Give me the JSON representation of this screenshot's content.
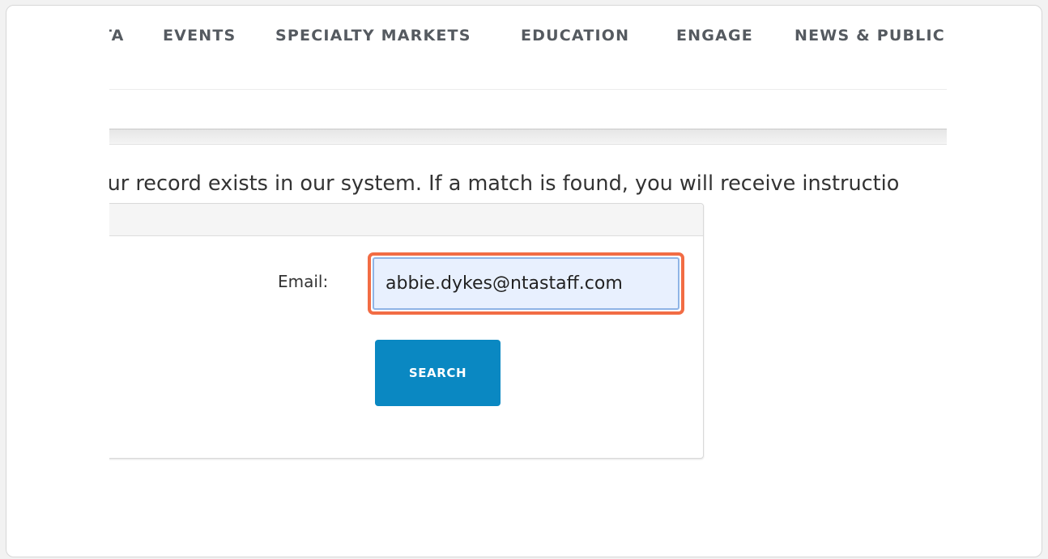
{
  "nav": {
    "items": [
      {
        "label": "TA"
      },
      {
        "label": "EVENTS"
      },
      {
        "label": "SPECIALTY MARKETS"
      },
      {
        "label": "EDUCATION"
      },
      {
        "label": "ENGAGE"
      },
      {
        "label": "NEWS & PUBLIC"
      }
    ]
  },
  "main": {
    "intro_text": "our record exists in our system. If a match is found, you will receive instructio"
  },
  "form": {
    "email_label": "Email:",
    "email_value": "abbie.dykes@ntastaff.com",
    "search_label": "SEARCH"
  },
  "colors": {
    "highlight": "#f26c44",
    "button": "#0a88c2",
    "input_bg": "#e8f0fe"
  }
}
